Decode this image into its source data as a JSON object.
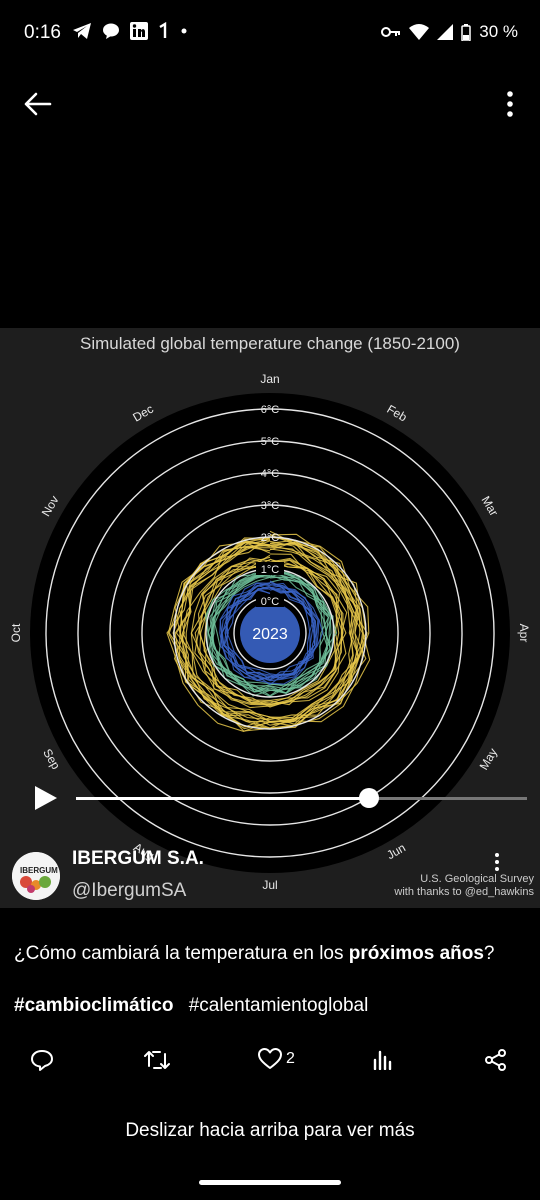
{
  "status_bar": {
    "time": "0:16",
    "notification_icons": [
      "telegram-icon",
      "chat-bubble-icon",
      "linkedin-icon",
      "one-icon",
      "dot-icon"
    ],
    "battery": "30 %"
  },
  "video": {
    "title": "Simulated global temperature change (1850-2100)",
    "months": [
      "Jan",
      "Feb",
      "Mar",
      "Apr",
      "May",
      "Jun",
      "Jul",
      "Aug",
      "Sep",
      "Oct",
      "Nov",
      "Dec"
    ],
    "ring_labels": [
      "6°C",
      "5°C",
      "4°C",
      "3°C",
      "2°C",
      "1°C",
      "0°C"
    ],
    "year": "2023",
    "progress": 0.65,
    "credit_line1": "U.S. Geological Survey",
    "credit_line2": "with thanks to @ed_hawkins",
    "colors": {
      "warm": "#e7c84a",
      "mid": "#6fbf9a",
      "cool": "#3a64c8"
    }
  },
  "account": {
    "name": "IBERGUM S.A.",
    "handle": "@IbergumSA",
    "avatar_text": "IBERGUM"
  },
  "post": {
    "text_1": "¿Cómo cambiará la temperatura en los ",
    "text_bold": "próximos años",
    "text_2": "?",
    "hashtag_1": "#cambioclimático",
    "hashtag_2": "#calentamientoglobal"
  },
  "actions": {
    "like_count": "2"
  },
  "swipe_hint": "Deslizar hacia arriba para ver más"
}
